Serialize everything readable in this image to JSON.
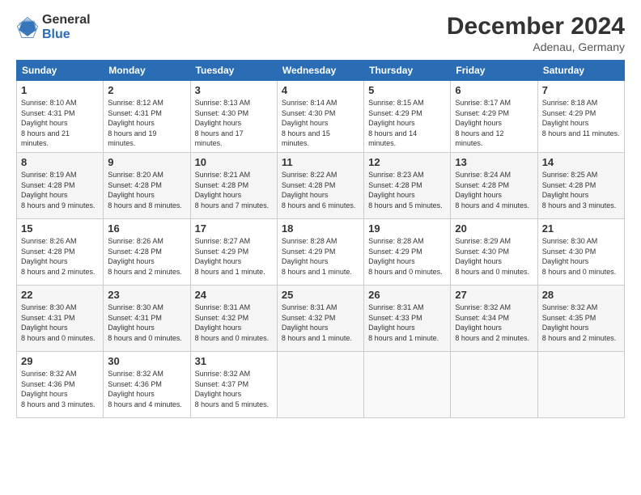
{
  "header": {
    "logo_general": "General",
    "logo_blue": "Blue",
    "month_title": "December 2024",
    "subtitle": "Adenau, Germany"
  },
  "calendar": {
    "days_of_week": [
      "Sunday",
      "Monday",
      "Tuesday",
      "Wednesday",
      "Thursday",
      "Friday",
      "Saturday"
    ],
    "weeks": [
      [
        null,
        {
          "day": "2",
          "sunrise": "8:12 AM",
          "sunset": "4:31 PM",
          "daylight": "8 hours and 19 minutes."
        },
        {
          "day": "3",
          "sunrise": "8:13 AM",
          "sunset": "4:30 PM",
          "daylight": "8 hours and 17 minutes."
        },
        {
          "day": "4",
          "sunrise": "8:14 AM",
          "sunset": "4:30 PM",
          "daylight": "8 hours and 15 minutes."
        },
        {
          "day": "5",
          "sunrise": "8:15 AM",
          "sunset": "4:29 PM",
          "daylight": "8 hours and 14 minutes."
        },
        {
          "day": "6",
          "sunrise": "8:17 AM",
          "sunset": "4:29 PM",
          "daylight": "8 hours and 12 minutes."
        },
        {
          "day": "7",
          "sunrise": "8:18 AM",
          "sunset": "4:29 PM",
          "daylight": "8 hours and 11 minutes."
        }
      ],
      [
        {
          "day": "1",
          "sunrise": "8:10 AM",
          "sunset": "4:31 PM",
          "daylight": "8 hours and 21 minutes."
        },
        {
          "day": "9",
          "sunrise": "8:20 AM",
          "sunset": "4:28 PM",
          "daylight": "8 hours and 8 minutes."
        },
        {
          "day": "10",
          "sunrise": "8:21 AM",
          "sunset": "4:28 PM",
          "daylight": "8 hours and 7 minutes."
        },
        {
          "day": "11",
          "sunrise": "8:22 AM",
          "sunset": "4:28 PM",
          "daylight": "8 hours and 6 minutes."
        },
        {
          "day": "12",
          "sunrise": "8:23 AM",
          "sunset": "4:28 PM",
          "daylight": "8 hours and 5 minutes."
        },
        {
          "day": "13",
          "sunrise": "8:24 AM",
          "sunset": "4:28 PM",
          "daylight": "8 hours and 4 minutes."
        },
        {
          "day": "14",
          "sunrise": "8:25 AM",
          "sunset": "4:28 PM",
          "daylight": "8 hours and 3 minutes."
        }
      ],
      [
        {
          "day": "8",
          "sunrise": "8:19 AM",
          "sunset": "4:28 PM",
          "daylight": "8 hours and 9 minutes."
        },
        {
          "day": "16",
          "sunrise": "8:26 AM",
          "sunset": "4:28 PM",
          "daylight": "8 hours and 2 minutes."
        },
        {
          "day": "17",
          "sunrise": "8:27 AM",
          "sunset": "4:29 PM",
          "daylight": "8 hours and 1 minute."
        },
        {
          "day": "18",
          "sunrise": "8:28 AM",
          "sunset": "4:29 PM",
          "daylight": "8 hours and 1 minute."
        },
        {
          "day": "19",
          "sunrise": "8:28 AM",
          "sunset": "4:29 PM",
          "daylight": "8 hours and 0 minutes."
        },
        {
          "day": "20",
          "sunrise": "8:29 AM",
          "sunset": "4:30 PM",
          "daylight": "8 hours and 0 minutes."
        },
        {
          "day": "21",
          "sunrise": "8:30 AM",
          "sunset": "4:30 PM",
          "daylight": "8 hours and 0 minutes."
        }
      ],
      [
        {
          "day": "15",
          "sunrise": "8:26 AM",
          "sunset": "4:28 PM",
          "daylight": "8 hours and 2 minutes."
        },
        {
          "day": "23",
          "sunrise": "8:30 AM",
          "sunset": "4:31 PM",
          "daylight": "8 hours and 0 minutes."
        },
        {
          "day": "24",
          "sunrise": "8:31 AM",
          "sunset": "4:32 PM",
          "daylight": "8 hours and 0 minutes."
        },
        {
          "day": "25",
          "sunrise": "8:31 AM",
          "sunset": "4:32 PM",
          "daylight": "8 hours and 1 minute."
        },
        {
          "day": "26",
          "sunrise": "8:31 AM",
          "sunset": "4:33 PM",
          "daylight": "8 hours and 1 minute."
        },
        {
          "day": "27",
          "sunrise": "8:32 AM",
          "sunset": "4:34 PM",
          "daylight": "8 hours and 2 minutes."
        },
        {
          "day": "28",
          "sunrise": "8:32 AM",
          "sunset": "4:35 PM",
          "daylight": "8 hours and 2 minutes."
        }
      ],
      [
        {
          "day": "22",
          "sunrise": "8:30 AM",
          "sunset": "4:31 PM",
          "daylight": "8 hours and 0 minutes."
        },
        {
          "day": "30",
          "sunrise": "8:32 AM",
          "sunset": "4:36 PM",
          "daylight": "8 hours and 4 minutes."
        },
        {
          "day": "31",
          "sunrise": "8:32 AM",
          "sunset": "4:37 PM",
          "daylight": "8 hours and 5 minutes."
        },
        null,
        null,
        null,
        null
      ],
      [
        {
          "day": "29",
          "sunrise": "8:32 AM",
          "sunset": "4:36 PM",
          "daylight": "8 hours and 3 minutes."
        },
        null,
        null,
        null,
        null,
        null,
        null
      ]
    ]
  }
}
